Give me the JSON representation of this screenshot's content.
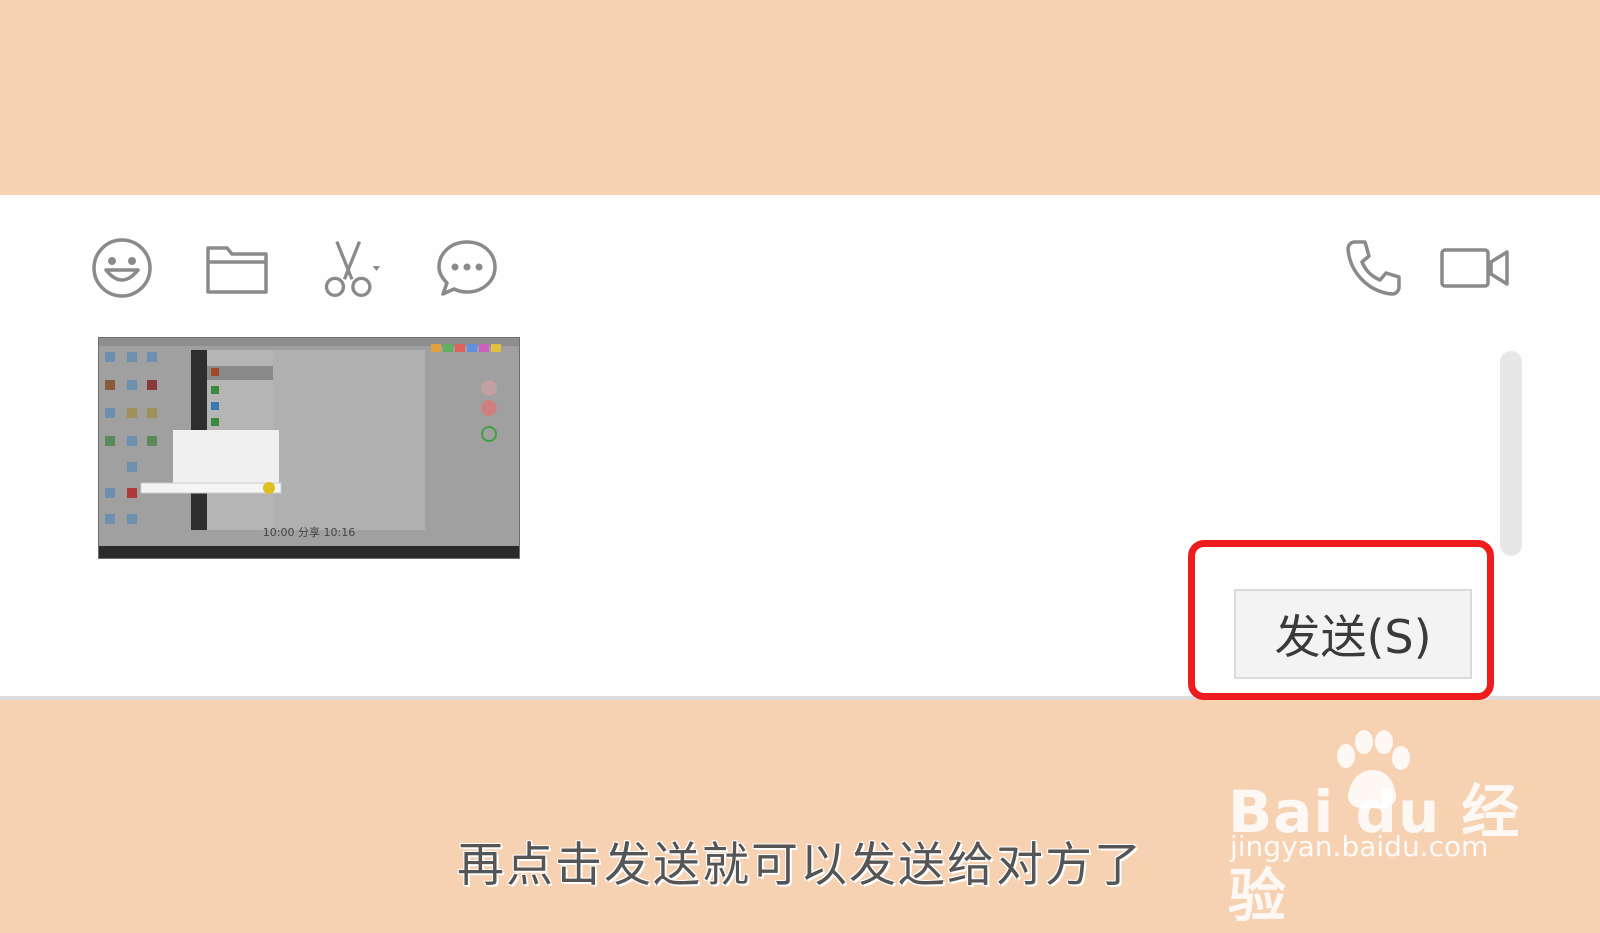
{
  "toolbar": {
    "left_tools": [
      {
        "name": "emoji-icon"
      },
      {
        "name": "folder-icon"
      },
      {
        "name": "scissors-icon"
      },
      {
        "name": "chat-history-icon"
      }
    ],
    "right_tools": [
      {
        "name": "phone-call-icon"
      },
      {
        "name": "video-call-icon"
      }
    ]
  },
  "composer": {
    "attachment": "screenshot-image",
    "screenshot_inner_text": "10:00 分享 10:16"
  },
  "send_button": {
    "label": "发送(S)",
    "highlight_color": "#ee1c1c"
  },
  "caption": "再点击发送就可以发送给对方了",
  "watermark": {
    "brand": "Bai du 经验",
    "url": "jingyan.baidu.com"
  },
  "colors": {
    "background": "#f6d1b2",
    "panel": "#fefefe",
    "icon": "#8a8a8a"
  }
}
